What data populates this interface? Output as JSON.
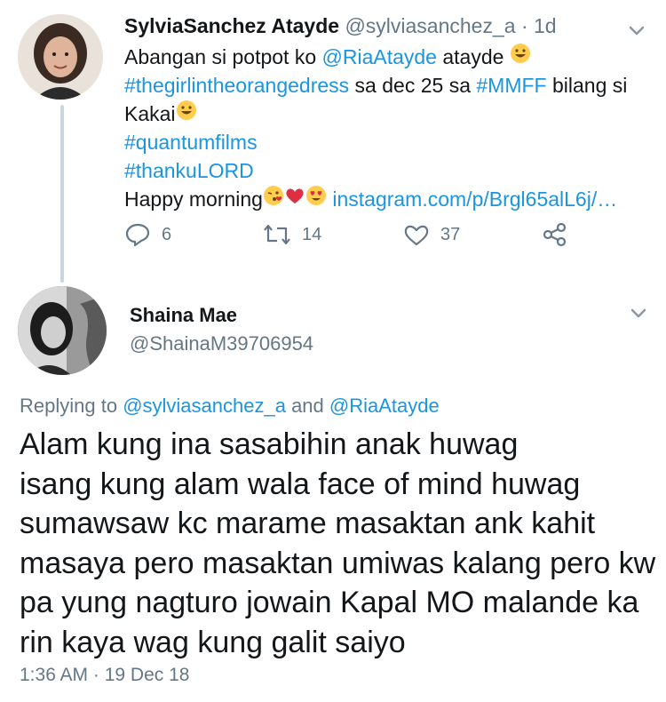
{
  "original_tweet": {
    "display_name": "SylviaSanchez Atayde",
    "handle": "@sylviasanchez_a",
    "time_sep": "·",
    "time": "1d",
    "lines": {
      "l1_text": "Abangan si potpot ko ",
      "l1_mention": "@RiaAtayde",
      "l1_after": " atayde ",
      "l2_hashtag": "#thegirlintheorangedress",
      "l2_text": " sa dec 25 sa ",
      "l2_hashtag2": "#MMFF",
      "l2_after": " bilang si",
      "l3_text": "Kakai",
      "l4_hashtag": "#quantumfilms",
      "l5_hashtag": "#thankuLORD",
      "l6_text": "Happy morning",
      "l6_link": "instagram.com/p/Brgl65alL6j/…"
    },
    "actions": {
      "reply_count": "6",
      "retweet_count": "14",
      "like_count": "37"
    }
  },
  "reply_tweet": {
    "display_name": "Shaina Mae",
    "handle": "@ShainaM39706954",
    "replying_prefix": "Replying to ",
    "replying_user1": "@sylviasanchez_a",
    "replying_and": " and ",
    "replying_user2": "@RiaAtayde",
    "text_lines": [
      "Alam kung ina sasabihin anak huwag",
      "isang kung alam wala face of mind huwag",
      "sumawsaw kc marame masaktan ank kahit",
      "masaya pero masaktan umiwas kalang pero kw",
      "pa yung nagturo jowain Kapal MO malande ka",
      "rin kaya wag kung galit saiyo"
    ],
    "timestamp": "1:36 AM · 19 Dec 18"
  },
  "colors": {
    "link": "#1b95e0",
    "secondary_text": "#657786",
    "thread_line": "#ccd6dd"
  },
  "icons": [
    "chevron-down-icon",
    "reply-icon",
    "retweet-icon",
    "like-icon",
    "share-icon",
    "grinning-emoji",
    "kiss-emoji",
    "heart-emoji",
    "heart-eyes-emoji"
  ]
}
